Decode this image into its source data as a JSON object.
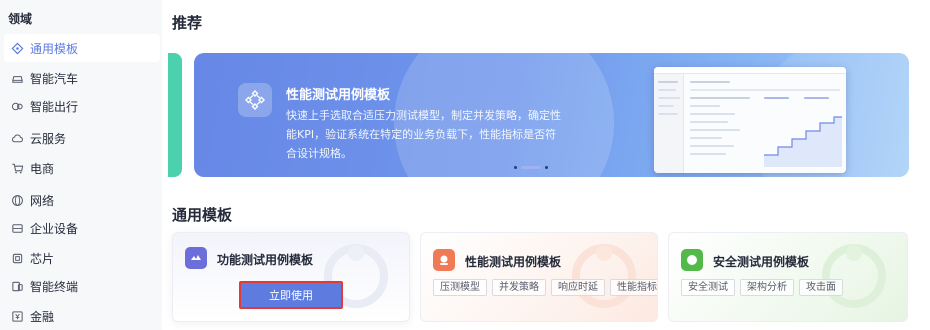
{
  "sidebar": {
    "title": "领域",
    "items": [
      {
        "label": "通用模板",
        "icon": "diamond-icon",
        "active": true
      },
      {
        "label": "智能汽车",
        "icon": "car-icon"
      },
      {
        "label": "智能出行",
        "icon": "travel-icon"
      },
      {
        "label": "云服务",
        "icon": "cloud-icon"
      },
      {
        "label": "电商",
        "icon": "cart-icon"
      },
      {
        "label": "网络",
        "icon": "globe-icon"
      },
      {
        "label": "企业设备",
        "icon": "server-icon"
      },
      {
        "label": "芯片",
        "icon": "chip-icon"
      },
      {
        "label": "智能终端",
        "icon": "device-icon"
      },
      {
        "label": "金融",
        "icon": "finance-icon"
      }
    ]
  },
  "main": {
    "recommend_title": "推荐",
    "banner": {
      "title": "性能测试用例模板",
      "description": "快速上手选取合适压力测试模型，制定并发策略，确定性能KPI，验证系统在特定的业务负载下，性能指标是否符合设计规格。",
      "slide_count": 3,
      "active_slide": 2
    },
    "general_title": "通用模板",
    "cards": [
      {
        "title": "功能测试用例模板",
        "button": "立即使用",
        "icon": "function-test-icon"
      },
      {
        "title": "性能测试用例模板",
        "tags": [
          "压测模型",
          "并发策略",
          "响应时延",
          "性能指标"
        ],
        "icon": "performance-test-icon"
      },
      {
        "title": "安全测试用例模板",
        "tags": [
          "安全测试",
          "架构分析",
          "攻击面"
        ],
        "icon": "security-test-icon"
      }
    ]
  },
  "colors": {
    "accent": "#5e7ce0",
    "highlight_border": "#e03a3a",
    "banner_strip": "#4bd1ad"
  }
}
